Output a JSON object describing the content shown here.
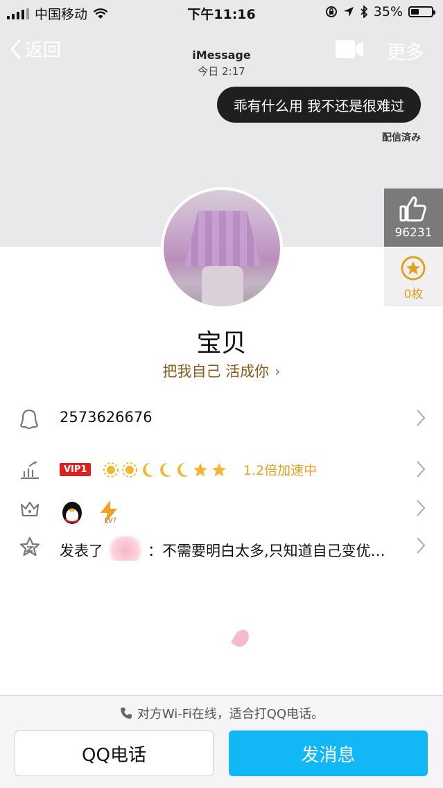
{
  "status_bar": {
    "carrier": "中国移动",
    "time": "下午11:16",
    "battery_percent": "35%",
    "battery_level": 0.35
  },
  "nav": {
    "back_label": "返回",
    "more_label": "更多"
  },
  "conversation": {
    "title": "iMessage",
    "date": "今日 2:17",
    "bubble_text": "乖有什么用 我不还是很难过",
    "delivered": "配信済み"
  },
  "stats": {
    "likes": "96231",
    "coins": "0枚"
  },
  "profile": {
    "name": "宝贝",
    "signature": "把我自己 活成你"
  },
  "rows": {
    "qq_number": "2573626676",
    "vip_badge": "VIP1",
    "speed_text": "1.2倍加速中",
    "level_badge": "LV7",
    "post_prefix": "发表了",
    "post_text": "：不需要明白太多,只知道自己变优…"
  },
  "bottom": {
    "wifi_note": "对方Wi-Fi在线，适合打QQ电话。",
    "call_button": "QQ电话",
    "message_button": "发消息"
  },
  "colors": {
    "accent_blue": "#12b7f5",
    "signature_brown": "#8a5a1a",
    "vip_red": "#e02020",
    "speed_orange": "#e8a020"
  }
}
